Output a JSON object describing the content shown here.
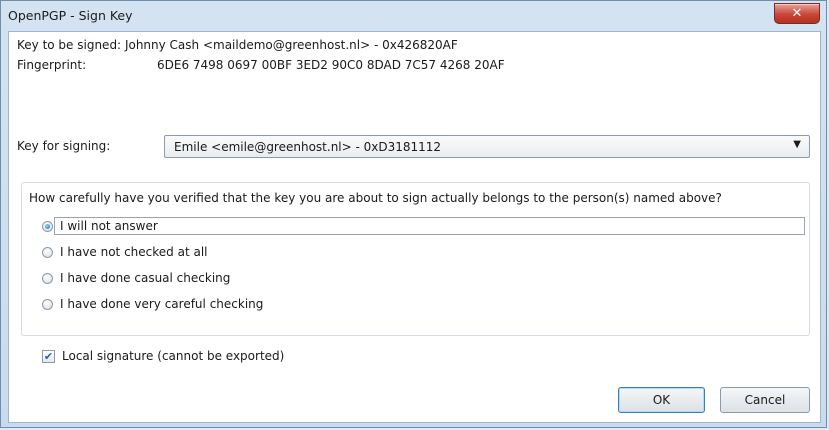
{
  "window": {
    "title": "OpenPGP - Sign Key",
    "close_symbol": "✕"
  },
  "key_info": {
    "signed_label": "Key to be signed:",
    "signed_value": "Johnny Cash <maildemo@greenhost.nl> - 0x426820AF",
    "fingerprint_label": "Fingerprint:",
    "fingerprint_value": "6DE6 7498 0697 00BF 3ED2 90C0 8DAD 7C57 4268 20AF"
  },
  "signing": {
    "label": "Key for signing:",
    "selected": "Emile <emile@greenhost.nl> - 0xD3181112",
    "arrow_icon": "▼"
  },
  "verification": {
    "question": "How carefully have you verified that the key you are about to sign actually belongs to the person(s) named above?",
    "options": [
      {
        "label": "I will not answer",
        "checked": true
      },
      {
        "label": "I have not checked at all",
        "checked": false
      },
      {
        "label": "I have done casual checking",
        "checked": false
      },
      {
        "label": "I have done very careful checking",
        "checked": false
      }
    ]
  },
  "local_signature": {
    "label": "Local signature (cannot be exported)",
    "checked": true,
    "check_mark": "✔"
  },
  "buttons": {
    "ok": "OK",
    "cancel": "Cancel"
  },
  "colors": {
    "accent": "#1d6ec8",
    "close": "#c9453a"
  }
}
